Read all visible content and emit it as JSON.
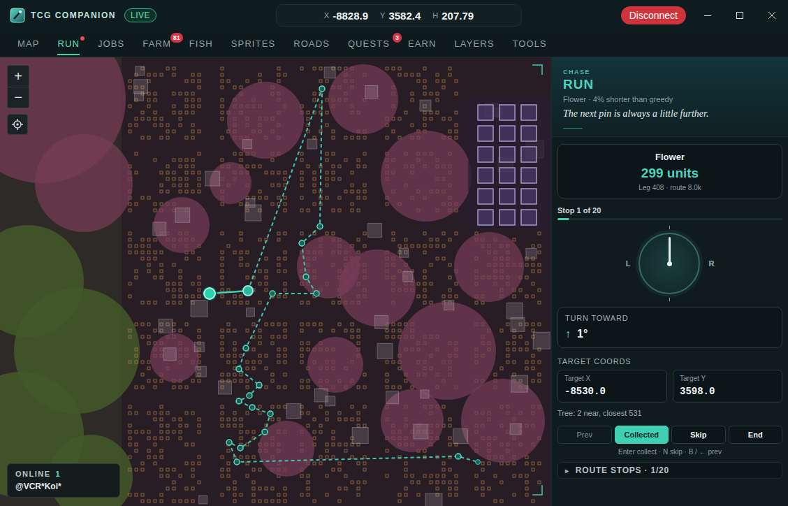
{
  "titlebar": {
    "title": "TCG COMPANION",
    "status": "LIVE",
    "disconnect": "Disconnect"
  },
  "coords": [
    {
      "axis": "X",
      "value": "-8828.9"
    },
    {
      "axis": "Y",
      "value": "3582.4"
    },
    {
      "axis": "H",
      "value": "207.79"
    }
  ],
  "tabs": [
    {
      "label": "MAP",
      "selected": false,
      "dot": false,
      "badge": ""
    },
    {
      "label": "RUN",
      "selected": true,
      "dot": true,
      "badge": ""
    },
    {
      "label": "JOBS",
      "selected": false,
      "dot": false,
      "badge": ""
    },
    {
      "label": "FARM",
      "selected": false,
      "dot": false,
      "badge": "81"
    },
    {
      "label": "FISH",
      "selected": false,
      "dot": false,
      "badge": ""
    },
    {
      "label": "SPRITES",
      "selected": false,
      "dot": false,
      "badge": ""
    },
    {
      "label": "ROADS",
      "selected": false,
      "dot": false,
      "badge": ""
    },
    {
      "label": "QUESTS",
      "selected": false,
      "dot": false,
      "badge": "3"
    },
    {
      "label": "EARN",
      "selected": false,
      "dot": false,
      "badge": ""
    },
    {
      "label": "LAYERS",
      "selected": false,
      "dot": false,
      "badge": ""
    },
    {
      "label": "TOOLS",
      "selected": false,
      "dot": false,
      "badge": ""
    }
  ],
  "map": {
    "zoom_in": "+",
    "zoom_out": "−",
    "online": {
      "label": "ONLINE",
      "count": "1",
      "user": "@VCR*Koi*"
    }
  },
  "panel": {
    "eyebrow": "CHASE",
    "title": "RUN",
    "subtitle": "Flower · 4% shorter than greedy",
    "tagline": "The next pin is always a little further."
  },
  "target_card": {
    "name": "Flower",
    "distance": "299 units",
    "detail": "Leg 408 · route 8.0k"
  },
  "progress": {
    "label": "Stop 1 of 20",
    "level": 0.05
  },
  "compass": {
    "left": "L",
    "right": "R",
    "needle_angle": 0
  },
  "turn": {
    "label": "TURN TOWARD",
    "arrow": "↑",
    "value": "1°"
  },
  "target_coords": {
    "label": "TARGET COORDS",
    "fields": [
      {
        "label": "Target X",
        "value": "-8530.0"
      },
      {
        "label": "Target Y",
        "value": "3598.0"
      }
    ]
  },
  "tree_info": "Tree: 2 near, closest 531",
  "actions": [
    {
      "label": "Prev",
      "kind": "ghost",
      "disabled": true
    },
    {
      "label": "Collected",
      "kind": "primary",
      "disabled": false
    },
    {
      "label": "Skip",
      "kind": "secondary",
      "disabled": false
    },
    {
      "label": "End",
      "kind": "secondary",
      "disabled": false
    }
  ],
  "shortcuts": "Enter collect · N skip · B / ← prev",
  "route_stops": {
    "toggle": "▸",
    "label": "ROUTE STOPS · 1/20",
    "expanded": false
  }
}
